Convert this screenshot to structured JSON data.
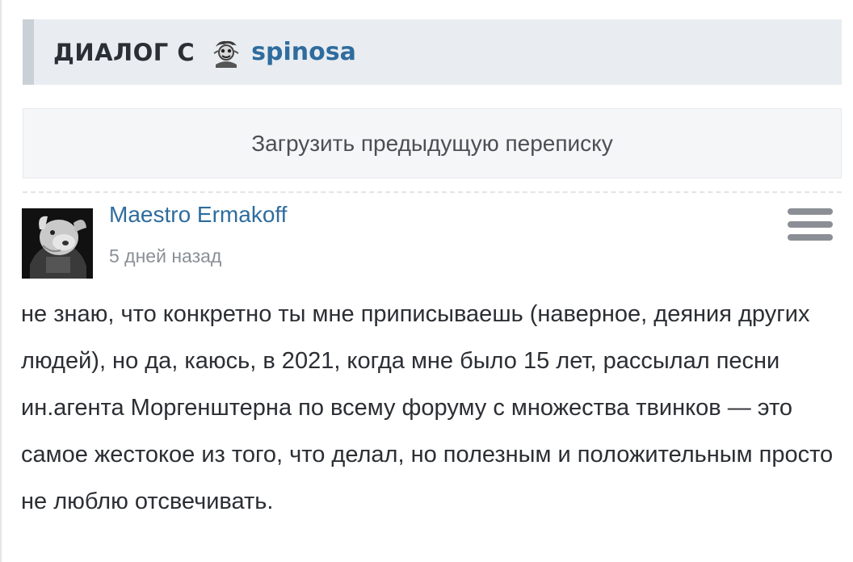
{
  "dialog": {
    "title": "ДИАЛОГ С",
    "username": "spinosa"
  },
  "load_more": {
    "label": "Загрузить предыдущую переписку"
  },
  "message": {
    "author": "Maestro Ermakoff",
    "time": "5 дней назад",
    "text": "не знаю, что конкретно ты мне приписываешь (наверное, деяния других людей), но да, каюсь, в 2021, когда мне было 15 лет, рассылал песни ин.агента Моргенштерна по всему форуму с множества твинков — это самое жестокое из того, что делал, но полезным и положительным просто не люблю отсвечивать."
  },
  "icons": {
    "menu": "hamburger-menu-icon",
    "title_avatar": "user-avatar-icon",
    "author_avatar": "author-avatar"
  },
  "colors": {
    "link": "#2f6c9e",
    "title_bg": "#e9edf1",
    "title_accent": "#c9d0d7",
    "text": "#2b2e33",
    "muted": "#8a8f96"
  }
}
